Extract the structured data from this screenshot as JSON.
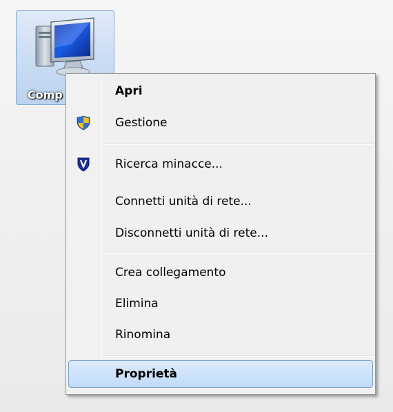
{
  "desktop": {
    "icon": {
      "name": "computer-icon",
      "label": "Comp"
    }
  },
  "context_menu": {
    "items": [
      {
        "label": "Apri",
        "bold": true
      },
      {
        "label": "Gestione",
        "icon": "uac-shield-icon"
      },
      {
        "label": "Ricerca minacce...",
        "icon": "security-shield-icon"
      },
      {
        "label": "Connetti unità di rete..."
      },
      {
        "label": "Disconnetti unità di rete..."
      },
      {
        "label": "Crea collegamento"
      },
      {
        "label": "Elimina"
      },
      {
        "label": "Rinomina"
      },
      {
        "label": "Proprietà",
        "bold": true,
        "selected": true
      }
    ]
  },
  "colors": {
    "selection_fill": "#c1dbfa",
    "selection_border": "#7da2ce",
    "menu_background": "#f0f0f0",
    "icon_selection": "#c9dcf3"
  }
}
